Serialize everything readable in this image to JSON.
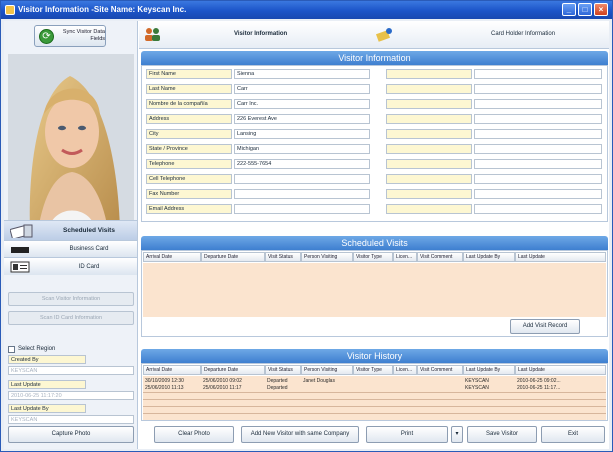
{
  "window": {
    "title": "Visitor Information -Site Name: Keyscan Inc."
  },
  "sidebar": {
    "sync_label": "Sync Visitor Data Fields",
    "nav": [
      {
        "label": "Scheduled Visits",
        "icon": "card-swipe-icon",
        "active": true
      },
      {
        "label": "Business Card",
        "icon": "business-card-icon",
        "active": false
      },
      {
        "label": "ID Card",
        "icon": "id-card-icon",
        "active": false
      }
    ],
    "scan_visitor": "Scan Visitor Information",
    "scan_id": "Scan ID Card Information",
    "select_region": "Select Region",
    "created_by_label": "Created By",
    "created_by_value": "KEYSCAN",
    "last_update_label": "Last Update",
    "last_update_value": "2010-06-25 11:17:20",
    "last_update_by_label": "Last Update By",
    "last_update_by_value": "KEYSCAN"
  },
  "tabs": [
    {
      "label": "Visitor Information",
      "icon": "visitors-icon",
      "active": true
    },
    {
      "label": "Card Holder Information",
      "icon": "card-holder-icon",
      "active": false
    }
  ],
  "visitor_info": {
    "title": "Visitor Information",
    "fields": [
      {
        "label": "First Name",
        "value": "Sienna"
      },
      {
        "label": "Last Name",
        "value": "Carr"
      },
      {
        "label": "Nombre de la compañía",
        "value": "Carr Inc."
      },
      {
        "label": "Address",
        "value": "226 Everest Ave"
      },
      {
        "label": "City",
        "value": "Lansing"
      },
      {
        "label": "State / Province",
        "value": "Michigan"
      },
      {
        "label": "Telephone",
        "value": "222-555-7654"
      },
      {
        "label": "Cell Telephone",
        "value": ""
      },
      {
        "label": "Fax Number",
        "value": ""
      },
      {
        "label": "Email Address",
        "value": ""
      }
    ]
  },
  "scheduled_visits": {
    "title": "Scheduled Visits",
    "columns": [
      "Arrival Date",
      "Departure Date",
      "Visit Status",
      "Person Visiting",
      "Visitor Type",
      "Licen...",
      "Visit Comment",
      "Last Update By",
      "Last Update"
    ],
    "add_button": "Add Visit Record"
  },
  "visitor_history": {
    "title": "Visitor History",
    "columns": [
      "Arrival Date",
      "Departure Date",
      "Visit Status",
      "Person Visiting",
      "Visitor Type",
      "Licen...",
      "Visit Comment",
      "Last Update By",
      "Last Update"
    ],
    "rows": [
      [
        "30/10/2009 12:30",
        "25/06/2010 09:02",
        "Departed",
        "Janet Douglas",
        "",
        "",
        "",
        "KEYSCAN",
        "2010-06-25 09:02..."
      ],
      [
        "25/06/2010 11:13",
        "25/06/2010 11:17",
        "Departed",
        "",
        "",
        "",
        "",
        "KEYSCAN",
        "2010-06-25 11:17..."
      ]
    ]
  },
  "footer": {
    "capture_photo": "Capture Photo",
    "clear_photo": "Clear Photo",
    "add_new_visitor": "Add New Visitor with same Company",
    "print": "Print",
    "save_visitor": "Save Visitor",
    "exit": "Exit"
  },
  "colors": {
    "title_bar": "#1c54c8",
    "section_band": "#4f8fd9",
    "grid_body": "#fbe4cf",
    "field_label": "#fdf7d2"
  }
}
